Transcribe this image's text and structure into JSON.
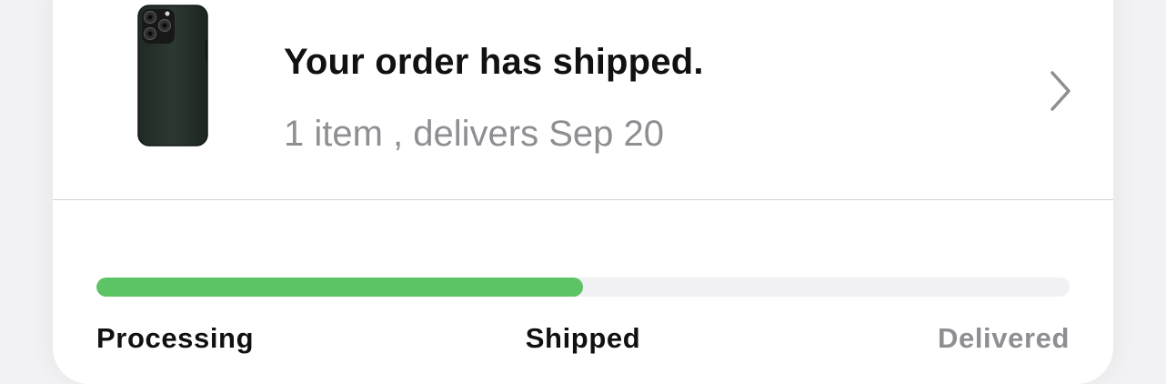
{
  "order": {
    "title": "Your order has shipped.",
    "subtitle": "1 item , delivers Sep 20",
    "product_icon": "phone-case-thumbnail",
    "chevron_icon": "chevron-right-icon"
  },
  "progress": {
    "fraction": 0.5,
    "fill_color": "#5dc466",
    "track_color": "#f0f0f5",
    "stages": [
      {
        "label": "Processing",
        "state": "complete"
      },
      {
        "label": "Shipped",
        "state": "current"
      },
      {
        "label": "Delivered",
        "state": "pending"
      }
    ]
  }
}
